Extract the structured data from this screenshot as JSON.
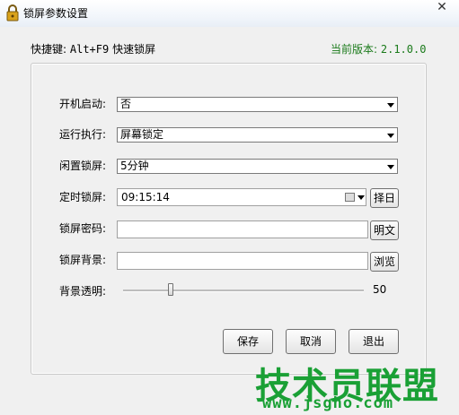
{
  "window": {
    "title": "锁屏参数设置",
    "close_glyph": "✕"
  },
  "header": {
    "hotkey_label": "快捷键:",
    "hotkey_keys": "Alt+F9",
    "hotkey_action": "快速锁屏",
    "version_label": "当前版本:",
    "version_value": "2.1.0.0"
  },
  "form": {
    "boot_start": {
      "label": "开机启动:",
      "value": "否"
    },
    "run_action": {
      "label": "运行执行:",
      "value": "屏幕锁定"
    },
    "idle_lock": {
      "label": "闲置锁屏:",
      "value": "5分钟"
    },
    "timed_lock": {
      "label": "定时锁屏:",
      "value": "09:15:14",
      "button": "择日"
    },
    "password": {
      "label": "锁屏密码:",
      "value": "",
      "button": "明文"
    },
    "background": {
      "label": "锁屏背景:",
      "value": "",
      "button": "浏览"
    },
    "opacity": {
      "label": "背景透明:",
      "value": 50,
      "min": 0,
      "max": 255,
      "display": "50"
    }
  },
  "buttons": {
    "save": "保存",
    "cancel": "取消",
    "exit": "退出"
  },
  "watermark": {
    "text": "技术员联盟",
    "url": "www.jsgho.com"
  },
  "colors": {
    "version": "#1a7a1a",
    "watermark": "#1aa035"
  }
}
